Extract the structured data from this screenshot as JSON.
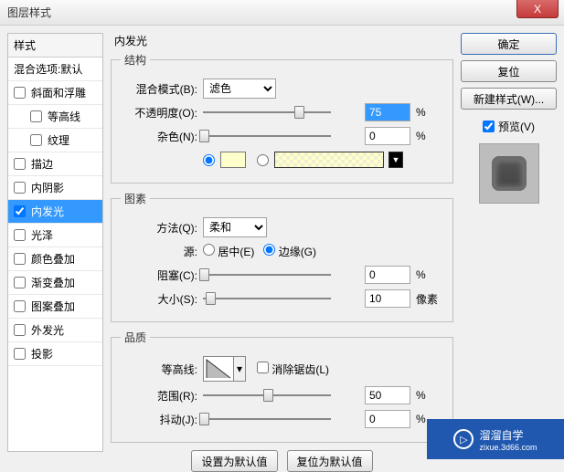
{
  "window": {
    "title": "图层样式",
    "close": "X"
  },
  "left": {
    "header": "样式",
    "blend_default": "混合选项:默认",
    "items": [
      {
        "label": "斜面和浮雕",
        "checked": false
      },
      {
        "label": "等高线",
        "checked": false,
        "indent": true
      },
      {
        "label": "纹理",
        "checked": false,
        "indent": true
      },
      {
        "label": "描边",
        "checked": false
      },
      {
        "label": "内阴影",
        "checked": false
      },
      {
        "label": "内发光",
        "checked": true,
        "selected": true
      },
      {
        "label": "光泽",
        "checked": false
      },
      {
        "label": "颜色叠加",
        "checked": false
      },
      {
        "label": "渐变叠加",
        "checked": false
      },
      {
        "label": "图案叠加",
        "checked": false
      },
      {
        "label": "外发光",
        "checked": false
      },
      {
        "label": "投影",
        "checked": false
      }
    ]
  },
  "center": {
    "title": "内发光",
    "structure": {
      "legend": "结构",
      "blend_mode_label": "混合模式(B):",
      "blend_mode_value": "滤色",
      "opacity_label": "不透明度(O):",
      "opacity_value": "75",
      "opacity_unit": "%",
      "noise_label": "杂色(N):",
      "noise_value": "0",
      "noise_unit": "%",
      "color1": "#ffffcc",
      "pattern_dd": "▼"
    },
    "elements": {
      "legend": "图素",
      "method_label": "方法(Q):",
      "method_value": "柔和",
      "source_label": "源:",
      "source_center": "居中(E)",
      "source_edge": "边缘(G)",
      "choke_label": "阻塞(C):",
      "choke_value": "0",
      "choke_unit": "%",
      "size_label": "大小(S):",
      "size_value": "10",
      "size_unit": "像素"
    },
    "quality": {
      "legend": "品质",
      "contour_label": "等高线:",
      "antialias_label": "消除锯齿(L)",
      "range_label": "范围(R):",
      "range_value": "50",
      "range_unit": "%",
      "jitter_label": "抖动(J):",
      "jitter_value": "0",
      "jitter_unit": "%"
    },
    "buttons": {
      "set_default": "设置为默认值",
      "reset_default": "复位为默认值"
    }
  },
  "right": {
    "ok": "确定",
    "cancel": "复位",
    "new_style": "新建样式(W)...",
    "preview_label": "预览(V)"
  },
  "watermark": {
    "brand": "溜溜自学",
    "url": "zixue.3d66.com",
    "play": "▷"
  }
}
